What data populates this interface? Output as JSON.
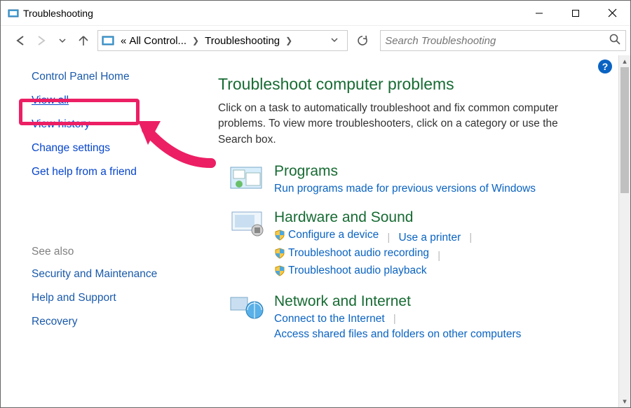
{
  "window": {
    "title": "Troubleshooting"
  },
  "address": {
    "part1": "All Control...",
    "part2": "Troubleshooting"
  },
  "search": {
    "placeholder": "Search Troubleshooting"
  },
  "leftpane": {
    "home": "Control Panel Home",
    "items": [
      "View all",
      "View history",
      "Change settings",
      "Get help from a friend"
    ],
    "seealso_label": "See also",
    "seealso": [
      "Security and Maintenance",
      "Help and Support",
      "Recovery"
    ]
  },
  "main": {
    "heading": "Troubleshoot computer problems",
    "description": "Click on a task to automatically troubleshoot and fix common computer problems. To view more troubleshooters, click on a category or use the Search box.",
    "categories": [
      {
        "title": "Programs",
        "links": [
          {
            "label": "Run programs made for previous versions of Windows",
            "shield": false
          }
        ]
      },
      {
        "title": "Hardware and Sound",
        "links": [
          {
            "label": "Configure a device",
            "shield": true
          },
          {
            "label": "Use a printer",
            "shield": false
          },
          {
            "label": "Troubleshoot audio recording",
            "shield": true
          },
          {
            "label": "Troubleshoot audio playback",
            "shield": true
          }
        ]
      },
      {
        "title": "Network and Internet",
        "links": [
          {
            "label": "Connect to the Internet",
            "shield": false
          },
          {
            "label": "Access shared files and folders on other computers",
            "shield": false
          }
        ]
      }
    ]
  },
  "annotation": {
    "highlighted_item": "View all"
  }
}
